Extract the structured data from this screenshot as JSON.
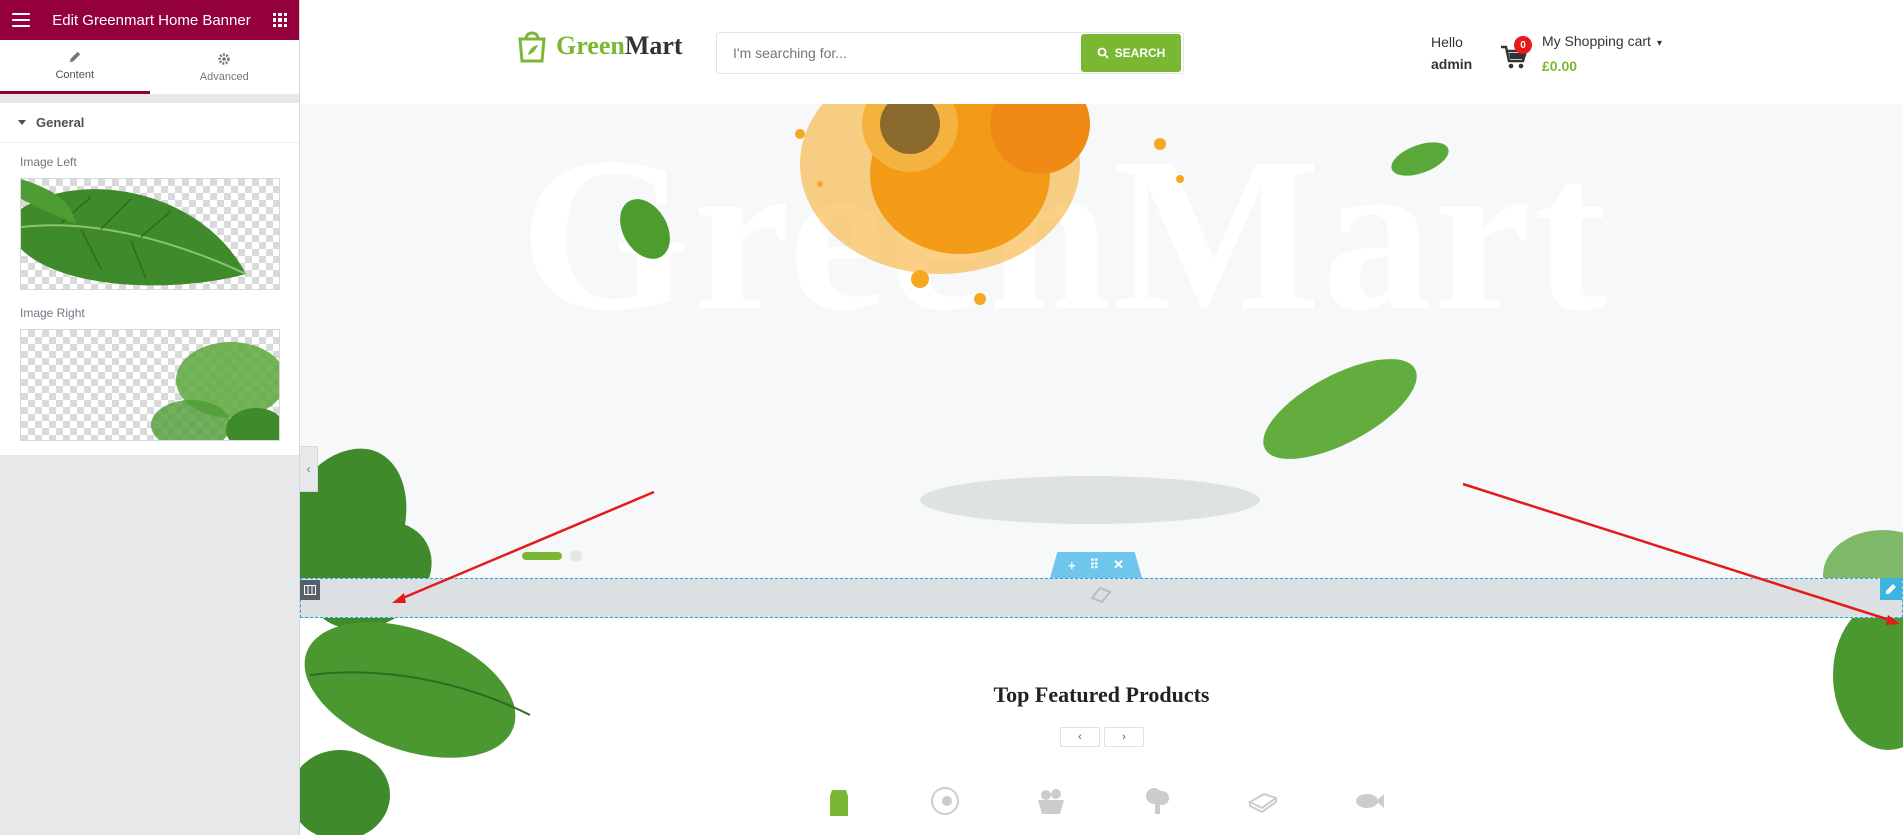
{
  "panel": {
    "title": "Edit Greenmart Home Banner",
    "tabs": [
      {
        "label": "Content",
        "icon": "pencil-icon",
        "active": true
      },
      {
        "label": "Advanced",
        "icon": "gear-icon",
        "active": false
      }
    ],
    "section": "General",
    "controls": [
      {
        "label": "Image Left"
      },
      {
        "label": "Image Right"
      }
    ],
    "accent": "#93003c"
  },
  "site": {
    "logo": {
      "part1": "Green",
      "part2": "Mart"
    },
    "search": {
      "placeholder": "I'm searching for...",
      "button": "SEARCH"
    },
    "greeting": {
      "hello": "Hello",
      "user": "admin"
    },
    "cart": {
      "count": "0",
      "label": "My Shopping cart",
      "amount": "£0.00"
    },
    "banner": {
      "bg_text": "GreenMart"
    },
    "featured": {
      "bold": "Top Featured",
      "rest": " Products"
    },
    "brand_color": "#7ab833"
  }
}
